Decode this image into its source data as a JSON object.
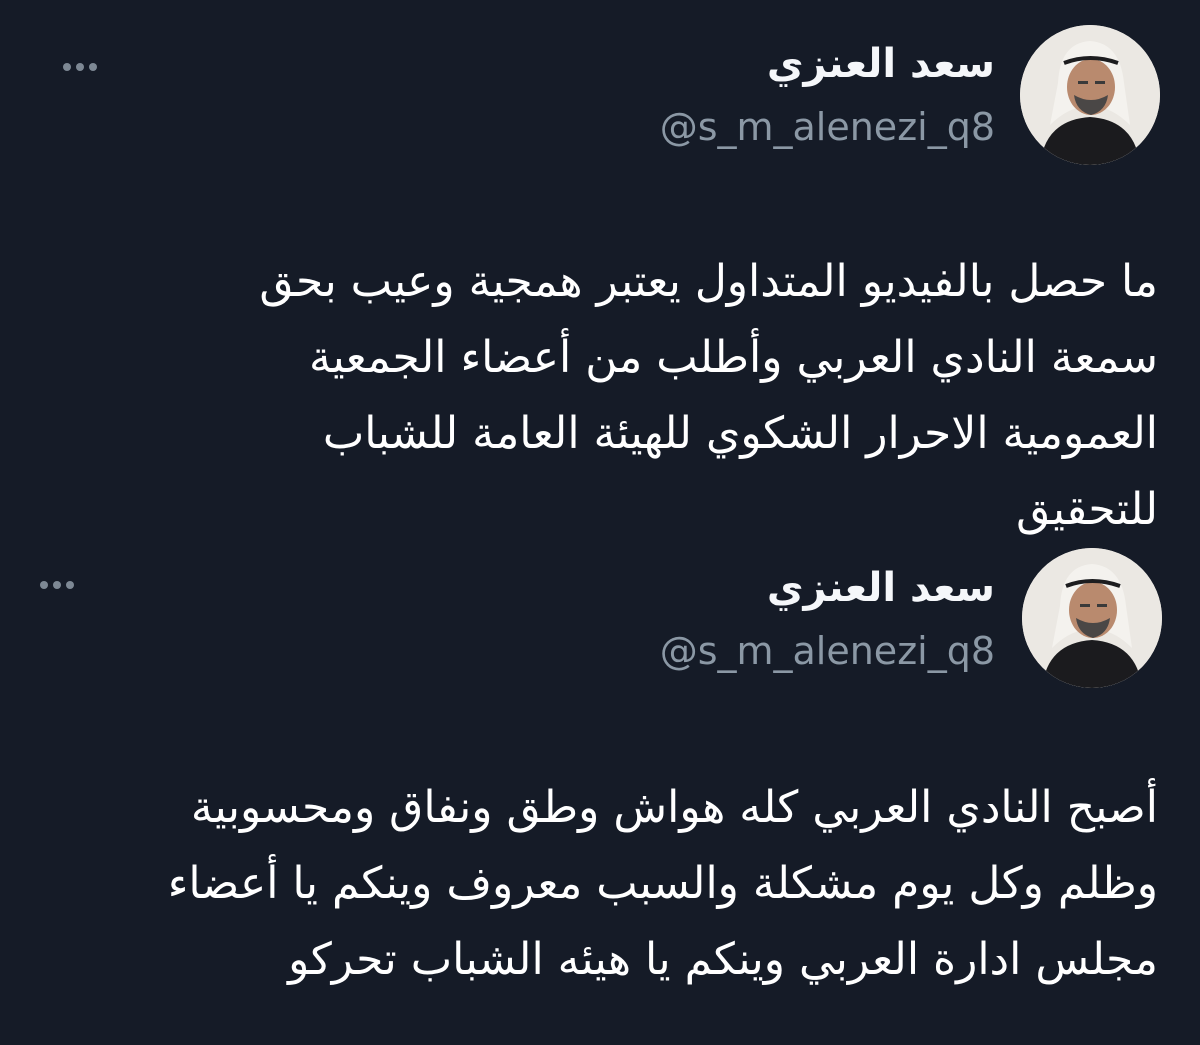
{
  "tweets": [
    {
      "author": {
        "display_name": "سعد العنزي",
        "handle": "@s_m_alenezi_q8"
      },
      "more_icon": "ellipsis-icon",
      "text_lines": [
        "ما حصل بالفيديو المتداول يعتبر همجية وعيب بحق",
        "سمعة النادي العربي وأطلب من أعضاء الجمعية",
        "العمومية الاحرار الشكوي للهيئة العامة للشباب",
        "للتحقيق"
      ]
    },
    {
      "author": {
        "display_name": "سعد العنزي",
        "handle": "@s_m_alenezi_q8"
      },
      "more_icon": "ellipsis-icon",
      "text_lines": [
        "أصبح النادي العربي كله هواش وطق ونفاق ومحسوبية",
        "وظلم وكل يوم مشكلة والسبب معروف وينكم يا أعضاء",
        "مجلس ادارة العربي وينكم يا هيئه الشباب تحركو"
      ]
    }
  ],
  "colors": {
    "background": "#151b27",
    "text": "#ffffff",
    "secondary_text": "#8b98a5"
  }
}
